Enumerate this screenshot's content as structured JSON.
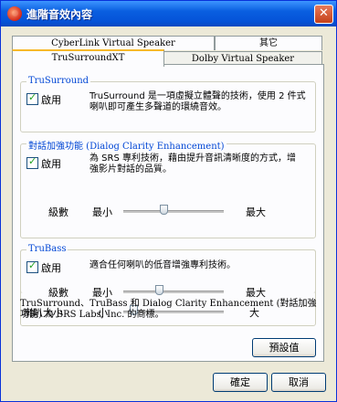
{
  "window": {
    "title": "進階音效內容"
  },
  "tabs": {
    "row1": [
      "CyberLink Virtual Speaker",
      "其它"
    ],
    "row2": [
      "TruSurroundXT",
      "Dolby Virtual Speaker"
    ],
    "active": "TruSurroundXT"
  },
  "trusurround": {
    "title": "TruSurround",
    "enable_label": "啟用",
    "enabled": true,
    "description": "TruSurround 是一項虛擬立體聲的技術，使用 2 件式喇叭即可產生多聲道的環繞音效。"
  },
  "dialog": {
    "title": "對話加強功能 (Dialog Clarity Enhancement)",
    "enable_label": "啟用",
    "enabled": true,
    "description": "為 SRS 專利技術，藉由提升音訊清晰度的方式，增強影片對話的品質。",
    "level_label": "級數",
    "min_label": "最小",
    "max_label": "最大",
    "level": 0.4
  },
  "trubass": {
    "title": "TruBass",
    "enable_label": "啟用",
    "enabled": true,
    "description": "適合任何喇叭的低音增強專利技術。",
    "level_label": "級數",
    "min_label": "最小",
    "max_label": "最大",
    "level": 0.35,
    "size_label": "喇叭大小",
    "small_label": "小",
    "large_label": "大",
    "size": 0.1
  },
  "footnote": "TruSurround、TruBass 和 Dialog Clarity Enhancement (對話加強功能) 為 SRS Labs, Inc. 的商標。",
  "buttons": {
    "default": "預設值",
    "ok": "確定",
    "cancel": "取消"
  }
}
